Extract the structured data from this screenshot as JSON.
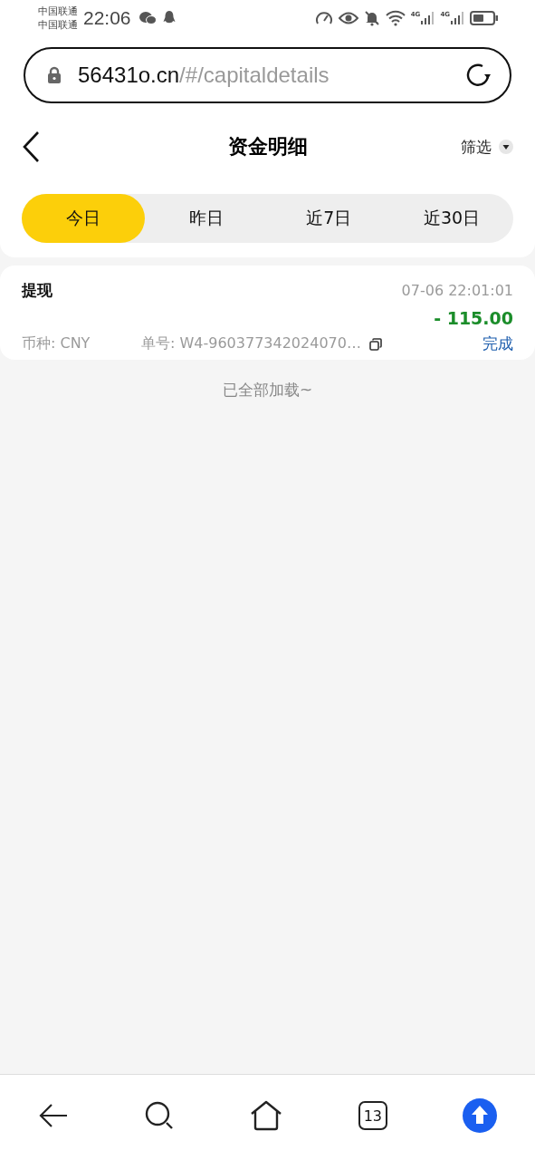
{
  "status_bar": {
    "carriers": [
      "中国联通",
      "中国联通"
    ],
    "time": "22:06",
    "networks": [
      "4G",
      "4G"
    ]
  },
  "address_bar": {
    "domain": "56431o.cn",
    "path": "/#/capitaldetails"
  },
  "header": {
    "title": "资金明细",
    "filter": "筛选"
  },
  "tabs": [
    {
      "label": "今日",
      "selected": true
    },
    {
      "label": "昨日",
      "selected": false
    },
    {
      "label": "近7日",
      "selected": false
    },
    {
      "label": "近30日",
      "selected": false
    }
  ],
  "records": [
    {
      "type": "提现",
      "time": "07-06 22:01:01",
      "amount": "- 115.00",
      "currency": "币种: CNY",
      "order": "单号: W4-960377342024070…",
      "status": "完成"
    }
  ],
  "end_note": "已全部加载~",
  "browser_nav": {
    "tab_count": "13"
  }
}
